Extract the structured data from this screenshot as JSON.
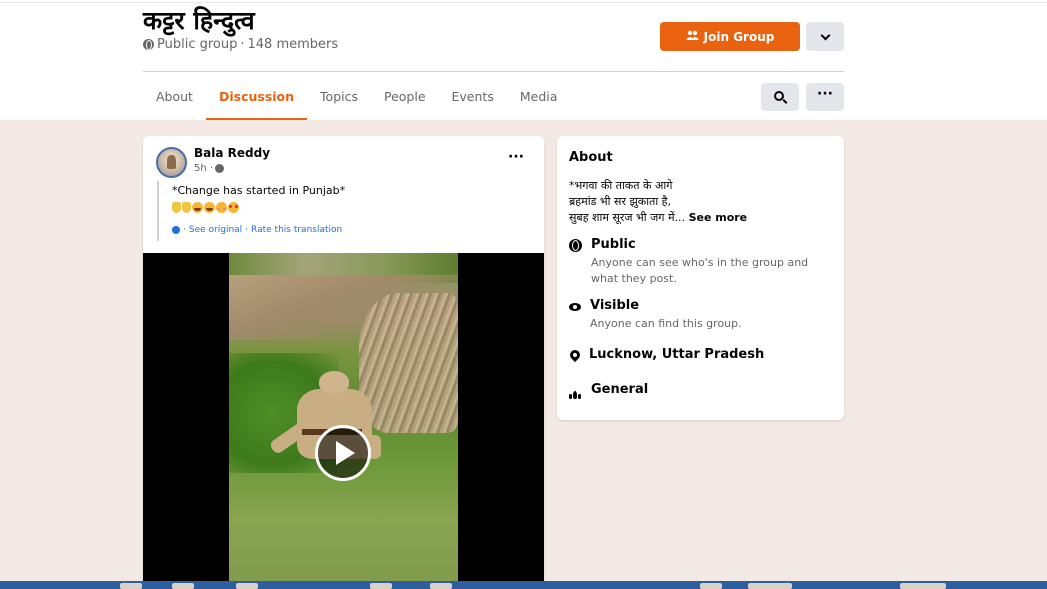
{
  "group": {
    "name": "कट्टर हिन्दुत्व",
    "privacy": "Public group",
    "separator": " · ",
    "members": "148 members",
    "join_label": "Join Group",
    "accent_color": "#e8620f"
  },
  "tabs": [
    {
      "label": "About",
      "active": false
    },
    {
      "label": "Discussion",
      "active": true
    },
    {
      "label": "Topics",
      "active": false
    },
    {
      "label": "People",
      "active": false
    },
    {
      "label": "Events",
      "active": false
    },
    {
      "label": "Media",
      "active": false
    }
  ],
  "toolbar": {
    "more_label": "···"
  },
  "post": {
    "author": "Bala Reddy",
    "time": "5h ·",
    "more_label": "···",
    "text": "*Change has started in Punjab*",
    "translate": {
      "see_original": "See original",
      "separator": " · ",
      "rate": "Rate this translation",
      "prefix": "·"
    }
  },
  "about": {
    "title": "About",
    "description_lines": [
      "*भगवा की ताकत के आगे",
      "ब्रहमांड भी सर झुकाता है,",
      "सुबह शाम सूरज भी जग में..."
    ],
    "see_more": "See more",
    "items": [
      {
        "icon": "globe-icon",
        "title": "Public",
        "subtitle": "Anyone can see who's in the group and what they post."
      },
      {
        "icon": "eye-icon",
        "title": "Visible",
        "subtitle": "Anyone can find this group."
      },
      {
        "icon": "location-pin-icon",
        "title": "Lucknow, Uttar Pradesh",
        "subtitle": ""
      },
      {
        "icon": "people-icon",
        "title": "General",
        "subtitle": ""
      }
    ]
  }
}
